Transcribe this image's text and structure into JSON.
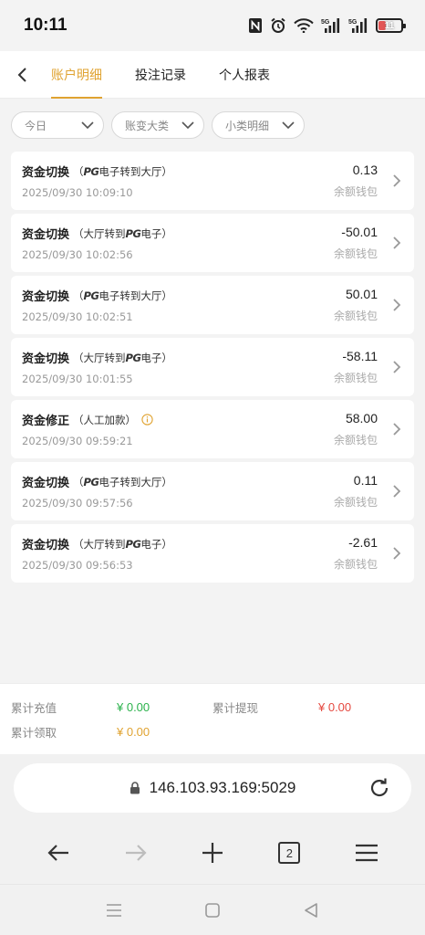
{
  "status_bar": {
    "time": "10:11",
    "battery": "11",
    "signal_1": "5G",
    "signal_2": "5G"
  },
  "nav": {
    "tabs": [
      {
        "label": "账户明细",
        "active": true
      },
      {
        "label": "投注记录",
        "active": false
      },
      {
        "label": "个人报表",
        "active": false
      }
    ]
  },
  "filters": [
    {
      "label": "今日"
    },
    {
      "label": "账变大类"
    },
    {
      "label": "小类明细"
    }
  ],
  "records": [
    {
      "type": "资金切换",
      "detail_prefix": "（",
      "detail_pg_pos": "before",
      "detail_text": "电子转到大厅）",
      "time": "2025/09/30 10:09:10",
      "amount": "0.13",
      "wallet": "余额钱包"
    },
    {
      "type": "资金切换",
      "detail_prefix": "（大厅转到",
      "detail_pg_pos": "after",
      "detail_text": "电子）",
      "time": "2025/09/30 10:02:56",
      "amount": "-50.01",
      "wallet": "余额钱包"
    },
    {
      "type": "资金切换",
      "detail_prefix": "（",
      "detail_pg_pos": "before",
      "detail_text": "电子转到大厅）",
      "time": "2025/09/30 10:02:51",
      "amount": "50.01",
      "wallet": "余额钱包"
    },
    {
      "type": "资金切换",
      "detail_prefix": "（大厅转到",
      "detail_pg_pos": "after",
      "detail_text": "电子）",
      "time": "2025/09/30 10:01:55",
      "amount": "-58.11",
      "wallet": "余额钱包"
    },
    {
      "type": "资金修正",
      "detail_prefix": "（人工加款）",
      "detail_pg_pos": "none",
      "detail_text": "",
      "time": "2025/09/30 09:59:21",
      "amount": "58.00",
      "wallet": "余额钱包"
    },
    {
      "type": "资金切换",
      "detail_prefix": "（",
      "detail_pg_pos": "before",
      "detail_text": "电子转到大厅）",
      "time": "2025/09/30 09:57:56",
      "amount": "0.11",
      "wallet": "余额钱包"
    },
    {
      "type": "资金切换",
      "detail_prefix": "（大厅转到",
      "detail_pg_pos": "after",
      "detail_text": "电子）",
      "time": "2025/09/30 09:56:53",
      "amount": "-2.61",
      "wallet": "余额钱包"
    }
  ],
  "pg_label": "PG",
  "summary": {
    "recharge_label": "累计充值",
    "recharge_value": "¥ 0.00",
    "withdraw_label": "累计提现",
    "withdraw_value": "¥ 0.00",
    "claim_label": "累计领取",
    "claim_value": "¥ 0.00"
  },
  "browser": {
    "url": "146.103.93.169:5029",
    "tabs_count": "2"
  },
  "colors": {
    "accent": "#e0a331",
    "recharge": "#2bb24c",
    "withdraw": "#e5483f",
    "claim": "#e0a331",
    "info_icon": "#e0a331"
  }
}
